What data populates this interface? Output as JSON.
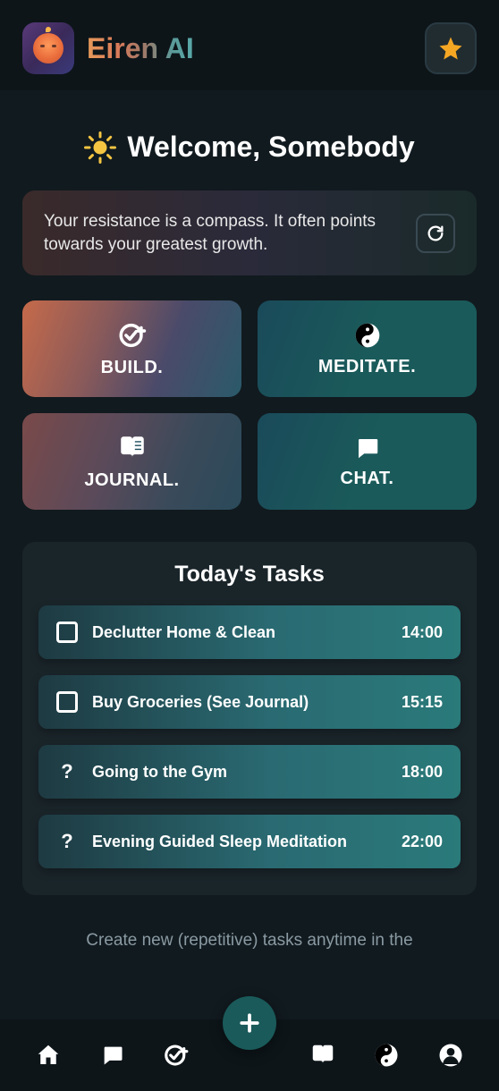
{
  "header": {
    "brand_name": "Eiren AI"
  },
  "welcome": {
    "greeting": "Welcome, Somebody"
  },
  "quote": {
    "text": "Your resistance is a compass. It often points towards your greatest growth."
  },
  "actions": {
    "build": "BUILD.",
    "meditate": "MEDITATE.",
    "journal": "JOURNAL.",
    "chat": "CHAT."
  },
  "tasks": {
    "title": "Today's Tasks",
    "items": [
      {
        "icon": "checkbox",
        "label": "Declutter Home & Clean",
        "time": "14:00"
      },
      {
        "icon": "checkbox",
        "label": "Buy Groceries (See Journal)",
        "time": "15:15"
      },
      {
        "icon": "question",
        "label": "Going to the Gym",
        "time": "18:00"
      },
      {
        "icon": "question",
        "label": "Evening Guided Sleep Meditation",
        "time": "22:00"
      }
    ],
    "footer": "Create new (repetitive) tasks anytime in the"
  }
}
